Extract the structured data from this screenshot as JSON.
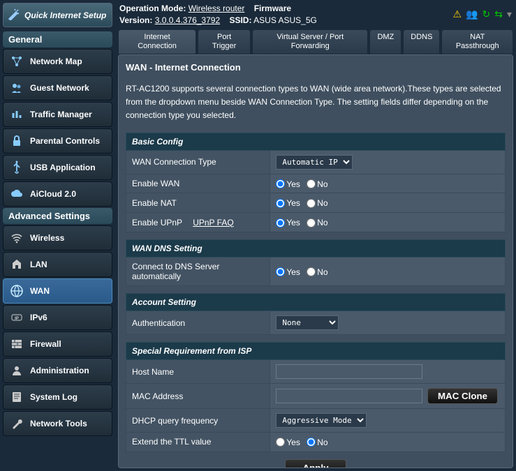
{
  "quick_setup_label": "Quick Internet Setup",
  "sidebar": {
    "general_header": "General",
    "advanced_header": "Advanced Settings",
    "general_items": [
      {
        "label": "Network Map"
      },
      {
        "label": "Guest Network"
      },
      {
        "label": "Traffic Manager"
      },
      {
        "label": "Parental Controls"
      },
      {
        "label": "USB Application"
      },
      {
        "label": "AiCloud 2.0"
      }
    ],
    "advanced_items": [
      {
        "label": "Wireless"
      },
      {
        "label": "LAN"
      },
      {
        "label": "WAN"
      },
      {
        "label": "IPv6"
      },
      {
        "label": "Firewall"
      },
      {
        "label": "Administration"
      },
      {
        "label": "System Log"
      },
      {
        "label": "Network Tools"
      }
    ]
  },
  "topbar": {
    "op_mode_label": "Operation Mode:",
    "op_mode_value": "Wireless router",
    "firmware_label": "Firmware Version:",
    "firmware_value": "3.0.0.4.376_3792",
    "ssid_label": "SSID:",
    "ssid_value": "ASUS ASUS_5G"
  },
  "tabs": [
    {
      "label": "Internet Connection"
    },
    {
      "label": "Port Trigger"
    },
    {
      "label": "Virtual Server / Port Forwarding"
    },
    {
      "label": "DMZ"
    },
    {
      "label": "DDNS"
    },
    {
      "label": "NAT Passthrough"
    }
  ],
  "page": {
    "title": "WAN - Internet Connection",
    "desc": "RT-AC1200 supports several connection types to WAN (wide area network).These types are selected from the dropdown menu beside WAN Connection Type. The setting fields differ depending on the connection type you selected.",
    "sections": {
      "basic": {
        "header": "Basic Config",
        "wan_type_label": "WAN Connection Type",
        "wan_type_value": "Automatic IP",
        "enable_wan_label": "Enable WAN",
        "enable_nat_label": "Enable NAT",
        "enable_upnp_label": "Enable UPnP",
        "upnp_faq": "UPnP  FAQ"
      },
      "dns": {
        "header": "WAN DNS Setting",
        "connect_dns_label": "Connect to DNS Server automatically"
      },
      "account": {
        "header": "Account Setting",
        "auth_label": "Authentication",
        "auth_value": "None"
      },
      "special": {
        "header": "Special Requirement from ISP",
        "hostname_label": "Host Name",
        "hostname_value": "",
        "mac_label": "MAC Address",
        "mac_value": "",
        "mac_clone_btn": "MAC Clone",
        "dhcp_freq_label": "DHCP query frequency",
        "dhcp_freq_value": "Aggressive Mode",
        "extend_ttl_label": "Extend the TTL value"
      }
    },
    "yes": "Yes",
    "no": "No",
    "apply": "Apply"
  }
}
